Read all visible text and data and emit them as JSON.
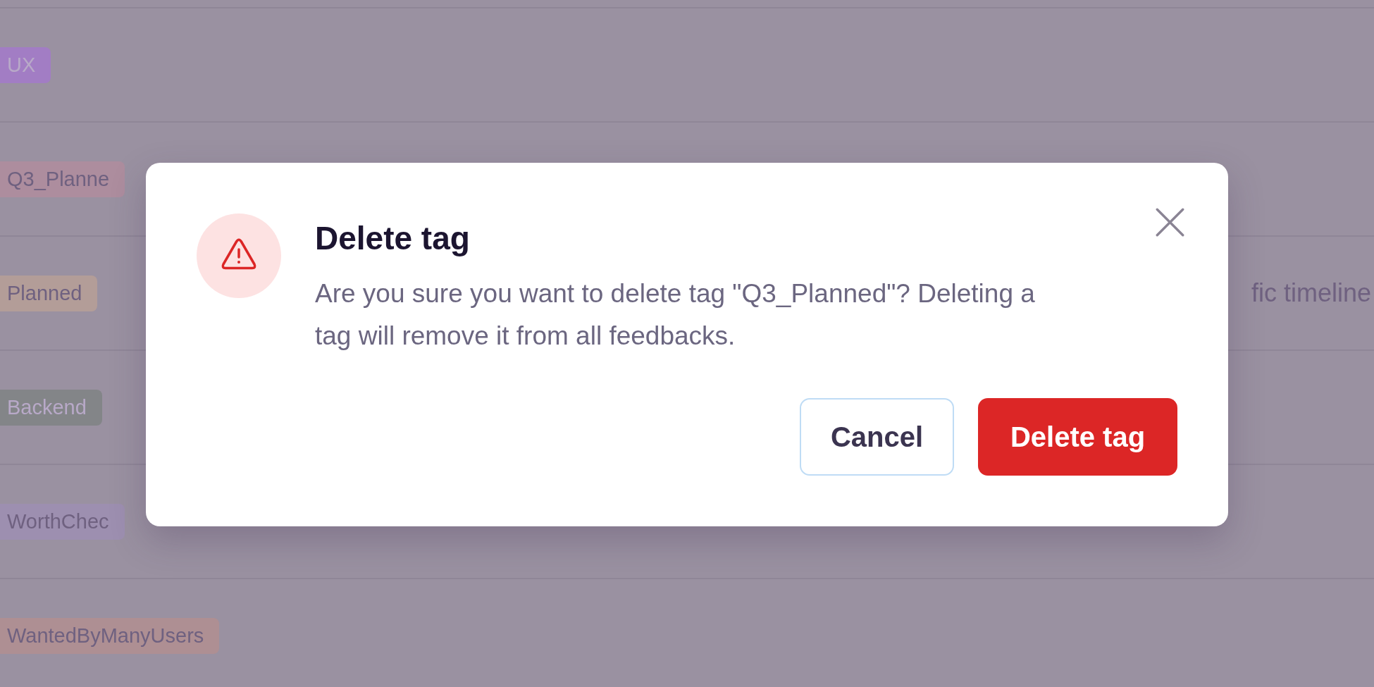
{
  "tags_table": {
    "rows": [
      {
        "tag": "UX",
        "color": "#a27dc4"
      },
      {
        "tag": "Q3_Planne",
        "color": "#ad8d9e"
      },
      {
        "tag": "Planned",
        "color": "#b39d98",
        "description": "fic timeline"
      },
      {
        "tag": "Backend",
        "color": "#838588"
      },
      {
        "tag": "WorthChec",
        "color": "#9d8fb0"
      },
      {
        "tag": "WantedByManyUsers",
        "color": "#ae8f93"
      }
    ]
  },
  "dialog": {
    "title": "Delete tag",
    "message": "Are you sure you want to delete tag \"Q3_Planned\"? Deleting a tag will remove it from all feedbacks.",
    "buttons": [
      {
        "label": "Cancel",
        "kind": "secondary"
      },
      {
        "label": "Delete tag",
        "kind": "danger"
      }
    ]
  }
}
